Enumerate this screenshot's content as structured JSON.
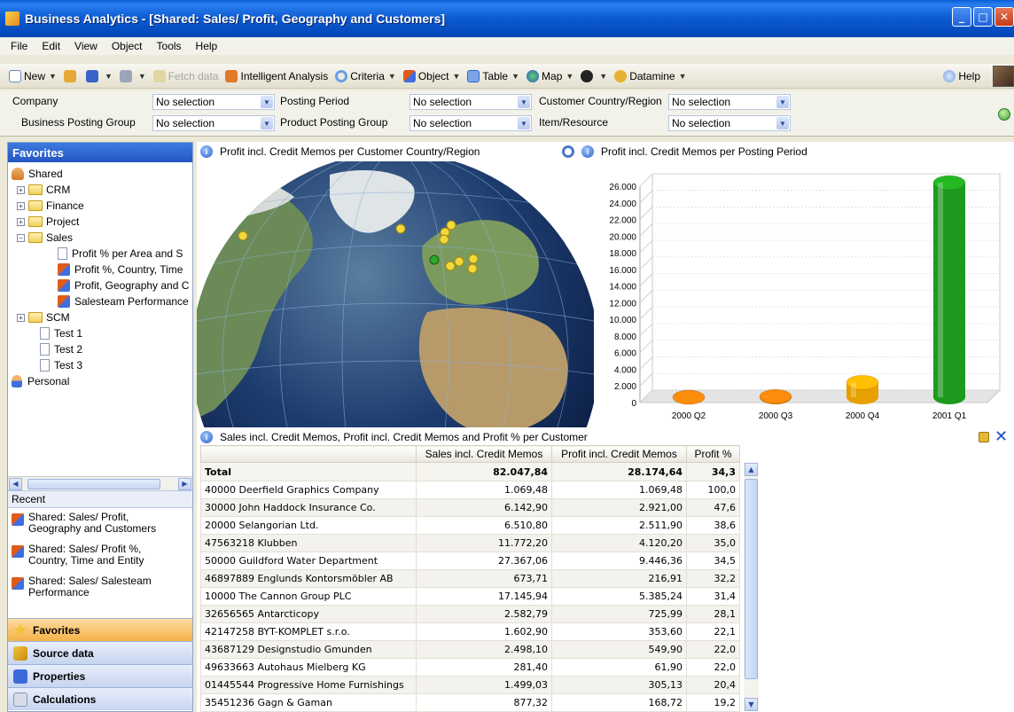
{
  "window": {
    "title": "Business Analytics - [Shared: Sales/ Profit, Geography and Customers]"
  },
  "menu": [
    "File",
    "Edit",
    "View",
    "Object",
    "Tools",
    "Help"
  ],
  "toolbar": {
    "new": "New",
    "fetch": "Fetch data",
    "intelligent": "Intelligent Analysis",
    "criteria": "Criteria",
    "object": "Object",
    "table": "Table",
    "map": "Map",
    "datamine": "Datamine",
    "help": "Help"
  },
  "filters": [
    {
      "label": "Company",
      "value": "No selection"
    },
    {
      "label": "Posting Period",
      "value": "No selection"
    },
    {
      "label": "Customer Country/Region",
      "value": "No selection"
    },
    {
      "label": "Business Posting Group",
      "value": "No selection"
    },
    {
      "label": "Product Posting Group",
      "value": "No selection"
    },
    {
      "label": "Item/Resource",
      "value": "No selection"
    }
  ],
  "favorites": {
    "header": "Favorites",
    "tree": {
      "shared": "Shared",
      "crm": "CRM",
      "finance": "Finance",
      "project": "Project",
      "sales": "Sales",
      "sales_items": [
        "Profit % per Area and S",
        "Profit %, Country, Time",
        "Profit, Geography and C",
        "Salesteam Performance"
      ],
      "scm": "SCM",
      "tests": [
        "Test 1",
        "Test 2",
        "Test 3"
      ],
      "personal": "Personal"
    }
  },
  "recent": {
    "header": "Recent",
    "items": [
      [
        "Shared: Sales/ Profit,",
        "Geography and Customers"
      ],
      [
        "Shared: Sales/ Profit %,",
        "Country, Time and Entity"
      ],
      [
        "Shared: Sales/ Salesteam",
        "Performance"
      ]
    ]
  },
  "nav": [
    "Favorites",
    "Source data",
    "Properties",
    "Calculations"
  ],
  "map": {
    "title": "Profit incl. Credit Memos per Customer Country/Region"
  },
  "bar_chart": {
    "title": "Profit incl. Credit Memos per Posting Period"
  },
  "chart_data": {
    "type": "bar",
    "categories": [
      "2000 Q2",
      "2000 Q3",
      "2000 Q4",
      "2001 Q1"
    ],
    "values": [
      200,
      300,
      2000,
      26000
    ],
    "ylim": [
      0,
      26000
    ],
    "yticks": [
      "0",
      "2.000",
      "4.000",
      "6.000",
      "8.000",
      "10.000",
      "12.000",
      "14.000",
      "16.000",
      "18.000",
      "20.000",
      "22.000",
      "24.000",
      "26.000"
    ],
    "colors": [
      "#d4750a",
      "#d4750a",
      "#e6a000",
      "#1e9a1e"
    ]
  },
  "table": {
    "title": "Sales incl. Credit Memos, Profit incl. Credit Memos and Profit % per Customer",
    "columns": [
      "",
      "Sales incl. Credit Memos",
      "Profit incl. Credit Memos",
      "Profit %"
    ],
    "total": [
      "Total",
      "82.047,84",
      "28.174,64",
      "34,3"
    ],
    "rows": [
      [
        "40000  Deerfield Graphics Company",
        "1.069,48",
        "1.069,48",
        "100,0"
      ],
      [
        "30000  John Haddock Insurance Co.",
        "6.142,90",
        "2.921,00",
        "47,6"
      ],
      [
        "20000  Selangorian Ltd.",
        "6.510,80",
        "2.511,90",
        "38,6"
      ],
      [
        "47563218  Klubben",
        "11.772,20",
        "4.120,20",
        "35,0"
      ],
      [
        "50000  Guildford Water Department",
        "27.367,06",
        "9.446,36",
        "34,5"
      ],
      [
        "46897889  Englunds Kontorsmöbler AB",
        "673,71",
        "216,91",
        "32,2"
      ],
      [
        "10000  The Cannon Group PLC",
        "17.145,94",
        "5.385,24",
        "31,4"
      ],
      [
        "32656565  Antarcticopy",
        "2.582,79",
        "725,99",
        "28,1"
      ],
      [
        "42147258  BYT-KOMPLET s.r.o.",
        "1.602,90",
        "353,60",
        "22,1"
      ],
      [
        "43687129  Designstudio Gmunden",
        "2.498,10",
        "549,90",
        "22,0"
      ],
      [
        "49633663  Autohaus Mielberg KG",
        "281,40",
        "61,90",
        "22,0"
      ],
      [
        "01445544  Progressive Home Furnishings",
        "1.499,03",
        "305,13",
        "20,4"
      ],
      [
        "35451236  Gagn & Gaman",
        "877,32",
        "168,72",
        "19,2"
      ]
    ]
  }
}
